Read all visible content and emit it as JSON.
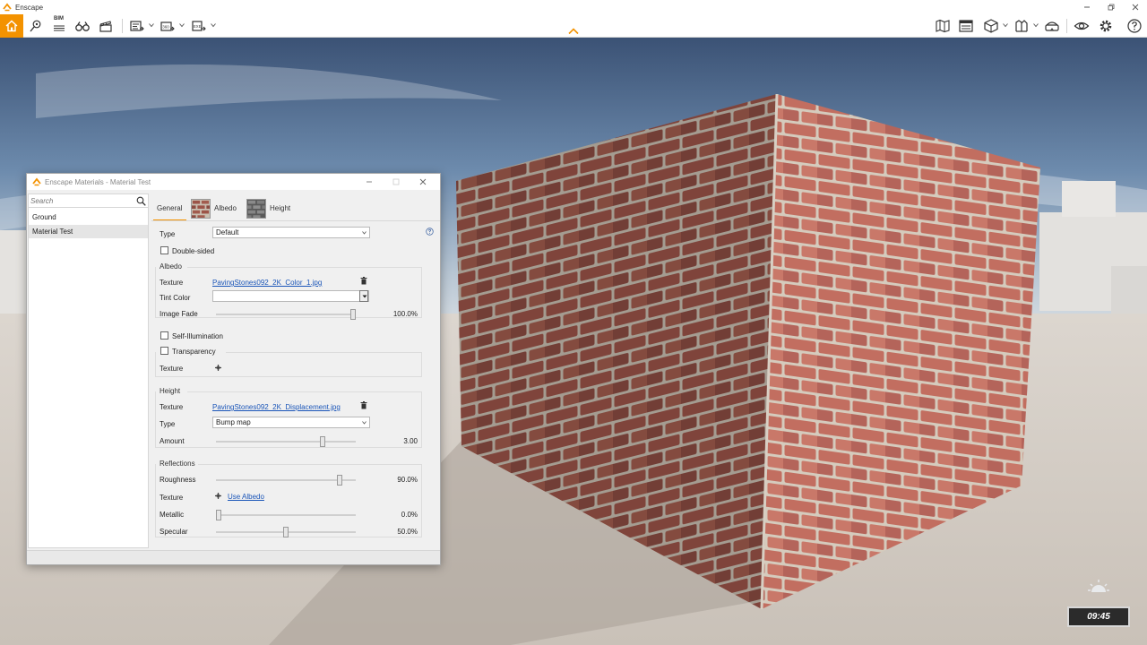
{
  "app": {
    "title": "Enscape",
    "accent_color": "#f39200"
  },
  "toolbar": {
    "bim_label": "BIM",
    "left_icons": [
      "home-icon",
      "location-pin-icon",
      "bim-icon",
      "binoculars-icon",
      "clapperboard-icon",
      "screenshot-export-icon",
      "panorama-export-icon",
      "exe-export-icon"
    ],
    "right_icons": [
      "map-icon",
      "video-editor-icon",
      "cube-icon",
      "asset-library-icon",
      "vr-headset-icon",
      "eye-visual-settings-icon",
      "gear-icon",
      "help-icon"
    ]
  },
  "materials_window": {
    "title": "Enscape Materials - Material Test",
    "search_placeholder": "Search",
    "materials": [
      "Ground",
      "Material Test"
    ],
    "selected_material": "Material Test",
    "tabs": [
      {
        "label": "General",
        "active": true
      },
      {
        "label": "Albedo"
      },
      {
        "label": "Height"
      }
    ],
    "general": {
      "type_label": "Type",
      "type_value": "Default",
      "double_sided_label": "Double-sided",
      "double_sided": false
    },
    "albedo": {
      "group_label": "Albedo",
      "texture_label": "Texture",
      "texture_file": "PavingStones092_2K_Color_1.jpg",
      "tint_label": "Tint Color",
      "tint_value": "",
      "image_fade_label": "Image Fade",
      "image_fade_value": "100.0%",
      "image_fade_fraction": 1.0
    },
    "self_illumination_label": "Self-Illumination",
    "transparency": {
      "label": "Transparency",
      "texture_label": "Texture"
    },
    "height": {
      "group_label": "Height",
      "texture_label": "Texture",
      "texture_file": "PavingStones092_2K_Displacement.jpg",
      "type_label": "Type",
      "type_value": "Bump map",
      "amount_label": "Amount",
      "amount_value": "3.00",
      "amount_fraction": 0.77
    },
    "reflections": {
      "group_label": "Reflections",
      "roughness_label": "Roughness",
      "roughness_value": "90.0%",
      "roughness_fraction": 0.9,
      "texture_label": "Texture",
      "texture_link": "Use Albedo",
      "metallic_label": "Metallic",
      "metallic_value": "0.0%",
      "metallic_fraction": 0.0,
      "specular_label": "Specular",
      "specular_value": "50.0%",
      "specular_fraction": 0.5
    }
  },
  "viewport": {
    "clock": "09:45"
  }
}
